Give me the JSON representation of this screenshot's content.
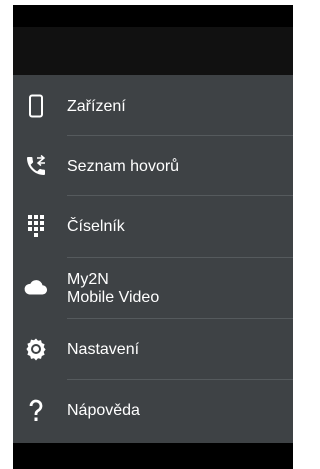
{
  "menu": {
    "items": [
      {
        "label": "Zařízení",
        "icon": "phone-device-icon"
      },
      {
        "label": "Seznam hovorů",
        "icon": "call-log-icon"
      },
      {
        "label": "Číselník",
        "icon": "dialpad-icon"
      },
      {
        "label_line1": "My2N",
        "label_line2": "Mobile Video",
        "icon": "cloud-icon"
      },
      {
        "label": "Nastavení",
        "icon": "gear-icon"
      },
      {
        "label": "Nápověda",
        "icon": "help-icon"
      }
    ]
  },
  "colors": {
    "drawer_background": "#3e4245",
    "action_bar": "#111111",
    "text": "#ffffff",
    "divider": "#555a5d"
  }
}
